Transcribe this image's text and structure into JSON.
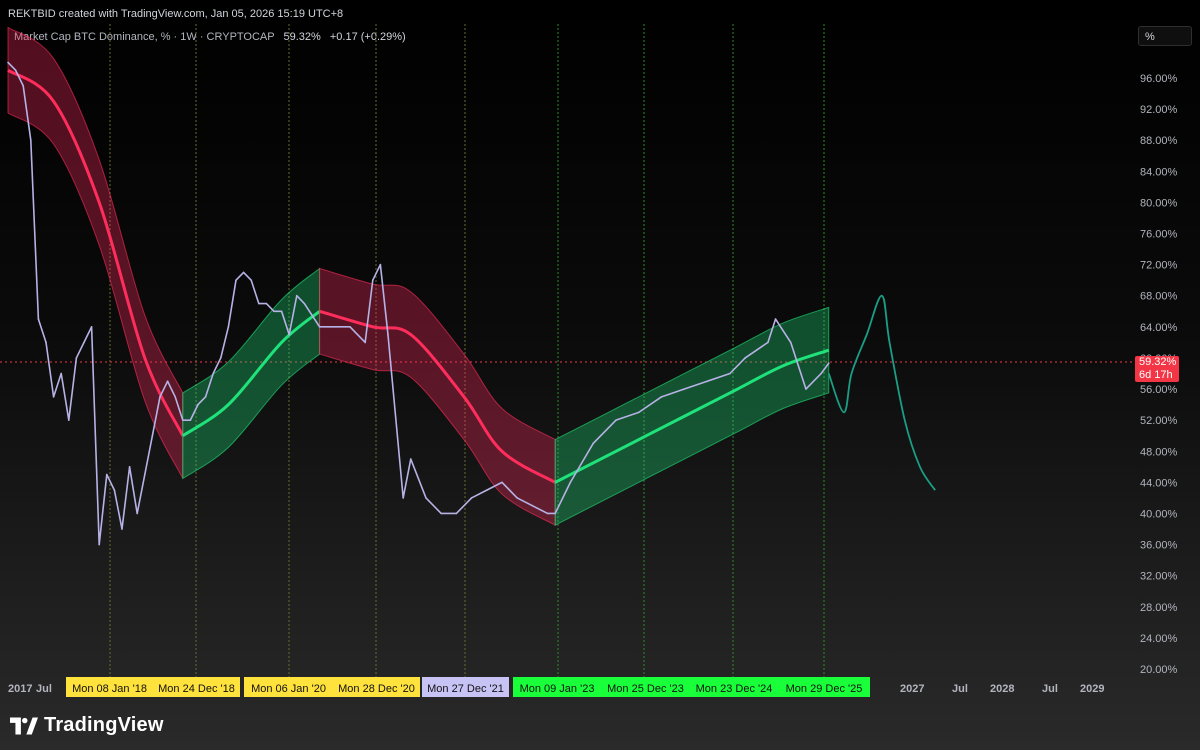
{
  "header": {
    "attribution": "REKTBID created with TradingView.com, Jan 05, 2026 15:19 UTC+8",
    "symbol": "Market Cap BTC Dominance, % · 1W · CRYPTOCAP",
    "last_value": "59.32%",
    "change": "+0.17 (+0.29%)",
    "unit_selector": "%"
  },
  "price_label": {
    "value": "59.32%",
    "countdown": "6d 17h",
    "color": "#f23645"
  },
  "brand": {
    "name": "TradingView"
  },
  "colors": {
    "price_line": "#b7b2e6",
    "band_bearish": "#ff2d5c",
    "band_bullish": "#1fe27a",
    "projection": "#1a9e86",
    "vline": "#7a8a3a"
  },
  "chart_data": {
    "type": "line",
    "title": "Market Cap BTC Dominance, % · 1W · CRYPTOCAP",
    "ylabel": "%",
    "ylim": [
      18,
      102
    ],
    "y_ticks": [
      "96.00%",
      "92.00%",
      "88.00%",
      "84.00%",
      "80.00%",
      "76.00%",
      "72.00%",
      "68.00%",
      "64.00%",
      "60.00%",
      "56.00%",
      "52.00%",
      "48.00%",
      "44.00%",
      "40.00%",
      "36.00%",
      "32.00%",
      "28.00%",
      "24.00%",
      "20.00%"
    ],
    "x_ticks_plain": [
      "2017",
      "Jul",
      "2027",
      "Jul",
      "2028",
      "Jul",
      "2029"
    ],
    "cycle_markers": [
      {
        "label": "Mon 08 Jan '18",
        "group": "yellow"
      },
      {
        "label": "Mon 24 Dec '18",
        "group": "yellow"
      },
      {
        "label": "Mon 06 Jan '20",
        "group": "yellow"
      },
      {
        "label": "Mon 28 Dec '20",
        "group": "yellow"
      },
      {
        "label": "Mon 27 Dec '21",
        "group": "lavender"
      },
      {
        "label": "Mon 09 Jan '23",
        "group": "green"
      },
      {
        "label": "Mon 25 Dec '23",
        "group": "green"
      },
      {
        "label": "Mon 23 Dec '24",
        "group": "green"
      },
      {
        "label": "Mon 29 Dec '25",
        "group": "green"
      }
    ],
    "series": [
      {
        "name": "Market Cap BTC Dominance",
        "x": [
          "2017-01",
          "2017-02",
          "2017-03",
          "2017-04",
          "2017-05",
          "2017-06",
          "2017-07",
          "2017-08",
          "2017-09",
          "2017-10",
          "2017-11",
          "2017-12",
          "2018-01",
          "2018-02",
          "2018-03",
          "2018-04",
          "2018-05",
          "2018-06",
          "2018-07",
          "2018-08",
          "2018-09",
          "2018-10",
          "2018-11",
          "2018-12",
          "2019-01",
          "2019-02",
          "2019-03",
          "2019-04",
          "2019-05",
          "2019-06",
          "2019-07",
          "2019-08",
          "2019-09",
          "2019-10",
          "2019-11",
          "2019-12",
          "2020-01",
          "2020-02",
          "2020-03",
          "2020-04",
          "2020-06",
          "2020-08",
          "2020-10",
          "2020-12",
          "2021-01",
          "2021-02",
          "2021-03",
          "2021-05",
          "2021-06",
          "2021-08",
          "2021-10",
          "2021-12",
          "2022-02",
          "2022-04",
          "2022-06",
          "2022-08",
          "2022-10",
          "2022-12",
          "2023-01",
          "2023-03",
          "2023-06",
          "2023-09",
          "2023-12",
          "2024-03",
          "2024-06",
          "2024-09",
          "2024-12",
          "2025-02",
          "2025-05",
          "2025-06",
          "2025-08",
          "2025-10",
          "2025-12",
          "2026-01"
        ],
        "values": [
          98,
          97,
          95,
          88,
          65,
          62,
          55,
          58,
          52,
          60,
          62,
          64,
          36,
          45,
          43,
          38,
          46,
          40,
          45,
          50,
          55,
          57,
          55,
          52,
          52,
          54,
          55,
          58,
          60,
          64,
          70,
          71,
          70,
          67,
          67,
          66,
          66,
          63,
          68,
          67,
          64,
          64,
          64,
          62,
          70,
          72,
          63,
          42,
          47,
          42,
          40,
          40,
          42,
          43,
          44,
          42,
          41,
          40,
          40,
          44,
          49,
          52,
          53,
          55,
          56,
          57,
          58,
          60,
          62,
          65,
          62,
          56,
          58,
          59.32
        ]
      },
      {
        "name": "Projection",
        "x": [
          "2026-01",
          "2026-03",
          "2026-04",
          "2026-06",
          "2026-08",
          "2026-09",
          "2026-11",
          "2027-01",
          "2027-03"
        ],
        "values": [
          58,
          53,
          58,
          63,
          68,
          62,
          52,
          46,
          43
        ]
      }
    ],
    "bands": [
      {
        "trend": "bearish",
        "x": [
          "2017-01",
          "2017-07",
          "2018-01",
          "2018-07",
          "2018-12"
        ],
        "mid": [
          97,
          93,
          80,
          60,
          50
        ]
      },
      {
        "trend": "bullish",
        "x": [
          "2018-12",
          "2019-06",
          "2020-01",
          "2020-06"
        ],
        "mid": [
          50,
          54,
          62,
          66
        ]
      },
      {
        "trend": "bearish",
        "x": [
          "2020-06",
          "2021-01",
          "2021-06",
          "2022-01",
          "2022-06",
          "2023-01"
        ],
        "mid": [
          66,
          64,
          63,
          55,
          48,
          44
        ]
      },
      {
        "trend": "bullish",
        "x": [
          "2023-01",
          "2023-07",
          "2024-01",
          "2024-07",
          "2025-01",
          "2025-07",
          "2026-01"
        ],
        "mid": [
          44,
          47,
          50,
          53,
          56,
          59,
          61
        ]
      }
    ]
  }
}
